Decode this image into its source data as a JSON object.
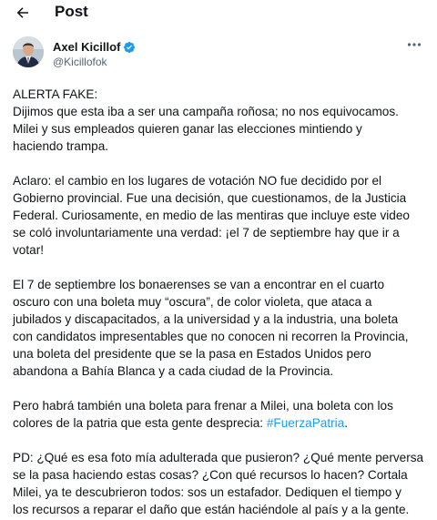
{
  "header": {
    "title": "Post",
    "back_icon": "arrow-left-icon"
  },
  "author": {
    "display_name": "Axel Kicillof",
    "handle": "@Kicillofok",
    "verified": true,
    "verified_color": "#1d9bf0",
    "more_icon": "more-horizontal-icon"
  },
  "tweet": {
    "paragraphs": [
      {
        "lines": [
          "ALERTA FAKE:",
          "Dijimos que esta iba a ser una campaña roñosa; no nos equivocamos.",
          "Milei y sus empleados quieren ganar las elecciones mintiendo y",
          "haciendo trampa."
        ]
      },
      {
        "lines": [
          "Aclaro: el cambio en los lugares de votación NO fue decidido por el",
          "Gobierno provincial. Fue una decisión, que cuestionamos, de la Justicia",
          "Federal. Curiosamente, en medio de las mentiras que incluye este video",
          "se coló involuntariamente una verdad: ¡el 7 de septiembre hay que ir a",
          "votar!"
        ]
      },
      {
        "lines": [
          "El 7 de septiembre los bonaerenses se van a encontrar en el cuarto",
          "oscuro con una boleta muy “oscura”, de color  violeta, que ataca a",
          "jubilados y discapacitados, a la universidad y a la industria, una boleta",
          "con candidatos impresentables que no conocen ni recorren la Provincia,",
          "una boleta del presidente que se la pasa en Estados Unidos pero",
          "abandona a Bahía Blanca y a cada ciudad de la Provincia."
        ]
      },
      {
        "lines": [
          "Pero habrá también una boleta para frenar a Milei, una boleta con los"
        ],
        "last_line_text": "colores de la patria que esta gente desprecia: ",
        "hashtag": "#FuerzaPatria",
        "after_hashtag": "."
      },
      {
        "lines": [
          "PD: ¿Qué es esa foto mía adulterada que pusieron? ¿Qué mente perversa",
          "se la pasa haciendo estas cosas? ¿Con qué recursos lo hacen? Cortala",
          "Milei, ya te descubrieron todos: sos un estafador. Dediquen el tiempo y",
          "los recursos a reparar el daño que están haciéndole al país y a la gente."
        ]
      }
    ]
  }
}
